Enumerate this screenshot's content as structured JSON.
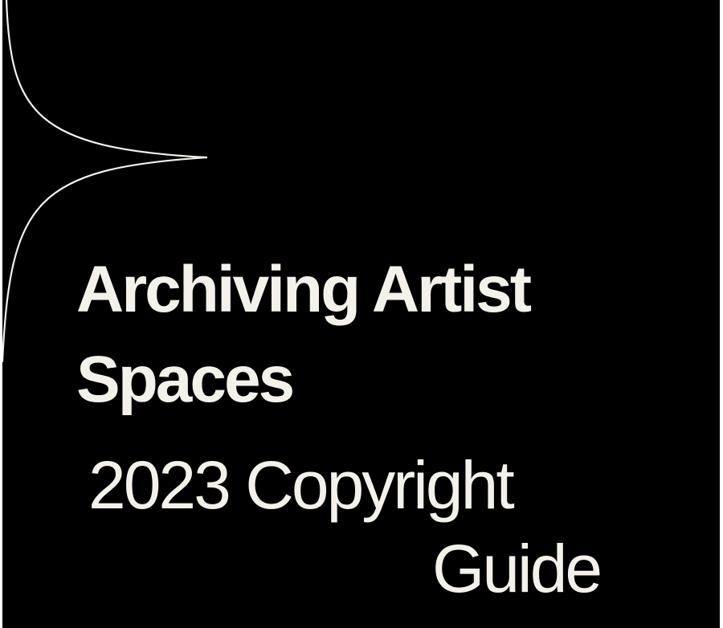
{
  "cover": {
    "background_color": "#000000",
    "text_color": "#f4f1ea",
    "title_lines": [
      "Archiving Artist",
      "Spaces"
    ],
    "subtitle_lines": [
      "2023 Copyright",
      "Guide"
    ],
    "decoration": "curved-star-flourish"
  }
}
